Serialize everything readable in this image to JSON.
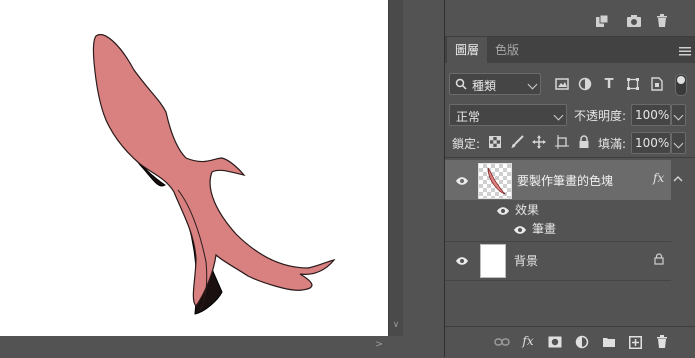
{
  "tabs": [
    {
      "label": "圖層",
      "active": true
    },
    {
      "label": "色版",
      "active": false
    }
  ],
  "filter": {
    "kind_label": "種類"
  },
  "blend": {
    "mode": "正常",
    "opacity_label": "不透明度:",
    "opacity_value": "100%"
  },
  "lock": {
    "label": "鎖定:",
    "fill_label": "填滿:",
    "fill_value": "100%"
  },
  "layers": [
    {
      "name": "要製作筆畫的色塊",
      "visible": true,
      "has_fx": true,
      "fx_label": "fx",
      "selected": true
    },
    {
      "name": "背景",
      "visible": true,
      "locked": true
    }
  ],
  "effects": {
    "group_label": "效果",
    "stroke_label": "筆畫"
  },
  "bottom_toolbar": {
    "fx_label": "fx"
  },
  "colors": {
    "panel_bg": "#535353",
    "selected_row": "#6b6b6b",
    "shape_fill": "#d98080",
    "shape_shadow": "#1a1010",
    "canvas": "#ffffff"
  },
  "icons": [
    "new-layer-icon",
    "camera-icon",
    "trash-icon",
    "search-icon",
    "image-filter-icon",
    "adjust-filter-icon",
    "type-filter-icon",
    "shape-filter-icon",
    "smart-filter-icon",
    "filter-toggle-icon",
    "panel-menu-icon",
    "lock-transparent-icon",
    "lock-pixels-icon",
    "lock-position-icon",
    "lock-artboard-icon",
    "lock-all-icon",
    "eye-icon",
    "lock-icon",
    "link-icon",
    "fx-icon",
    "mask-icon",
    "adjustment-icon",
    "folder-icon",
    "add-layer-icon"
  ]
}
